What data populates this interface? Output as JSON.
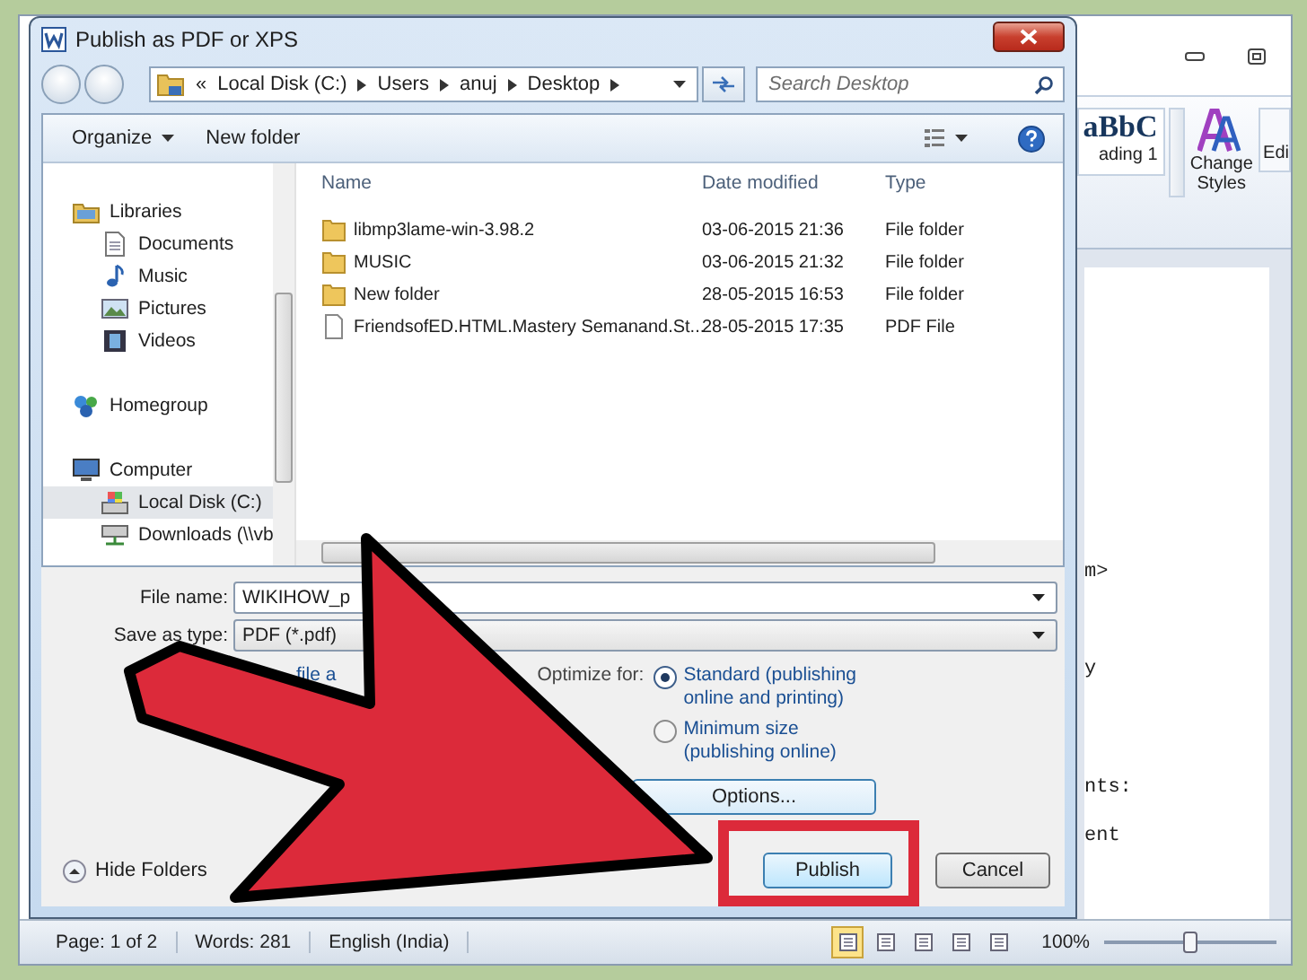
{
  "dialog": {
    "title": "Publish as PDF or XPS",
    "address": {
      "overflow": "«",
      "breadcrumb": [
        "Local Disk (C:)",
        "Users",
        "anuj",
        "Desktop"
      ]
    },
    "search": {
      "placeholder": "Search Desktop"
    },
    "toolbar": {
      "organize": "Organize",
      "new_folder": "New folder"
    },
    "nav": [
      {
        "label": "Libraries",
        "kind": "library",
        "selected": false,
        "children": [
          {
            "label": "Documents",
            "kind": "document",
            "selected": false
          },
          {
            "label": "Music",
            "kind": "music",
            "selected": false
          },
          {
            "label": "Pictures",
            "kind": "picture",
            "selected": false
          },
          {
            "label": "Videos",
            "kind": "video",
            "selected": false
          }
        ]
      },
      {
        "label": "Homegroup",
        "kind": "homegroup",
        "selected": false
      },
      {
        "label": "Computer",
        "kind": "computer",
        "selected": false,
        "children": [
          {
            "label": "Local Disk (C:)",
            "kind": "disk",
            "selected": true
          },
          {
            "label": "Downloads (\\\\vb",
            "kind": "network",
            "selected": false
          }
        ]
      }
    ],
    "columns": [
      "Name",
      "Date modified",
      "Type"
    ],
    "files": [
      {
        "name": "libmp3lame-win-3.98.2",
        "date": "03-06-2015 21:36",
        "type": "File folder",
        "kind": "folder"
      },
      {
        "name": "MUSIC",
        "date": "03-06-2015 21:32",
        "type": "File folder",
        "kind": "folder"
      },
      {
        "name": "New folder",
        "date": "28-05-2015 16:53",
        "type": "File folder",
        "kind": "folder"
      },
      {
        "name": "FriendsofED.HTML.Mastery Semanand.St...",
        "date": "28-05-2015 17:35",
        "type": "PDF File",
        "kind": "pdf"
      }
    ],
    "file_name": {
      "label": "File name:",
      "value": "WIKIHOW_p"
    },
    "save_as_type": {
      "label": "Save as type:",
      "value": "PDF (*.pdf)"
    },
    "open_after": {
      "label": "file a"
    },
    "optimize": {
      "label": "Optimize for:",
      "options": [
        {
          "label": "Standard (publishing online and printing)",
          "selected": true
        },
        {
          "label": "Minimum size (publishing online)",
          "selected": false
        }
      ]
    },
    "options_button": "Options...",
    "hide_folders": "Hide Folders",
    "publish": "Publish",
    "cancel": "Cancel"
  },
  "word": {
    "ribbon": {
      "style_preview": "aBbC",
      "style_name": "ading 1",
      "change_styles": "Change Styles",
      "editing": "Edi"
    },
    "document_lines": [
      "m>",
      "y",
      "nts:",
      "ent"
    ]
  },
  "status_bar": {
    "page": "Page: 1 of 2",
    "words": "Words: 281",
    "language": "English (India)",
    "views": [
      {
        "selected": true
      },
      {
        "selected": false
      },
      {
        "selected": false
      },
      {
        "selected": false
      },
      {
        "selected": false
      }
    ],
    "zoom": "100%",
    "zoom_slider": {
      "level": 0.5
    }
  }
}
